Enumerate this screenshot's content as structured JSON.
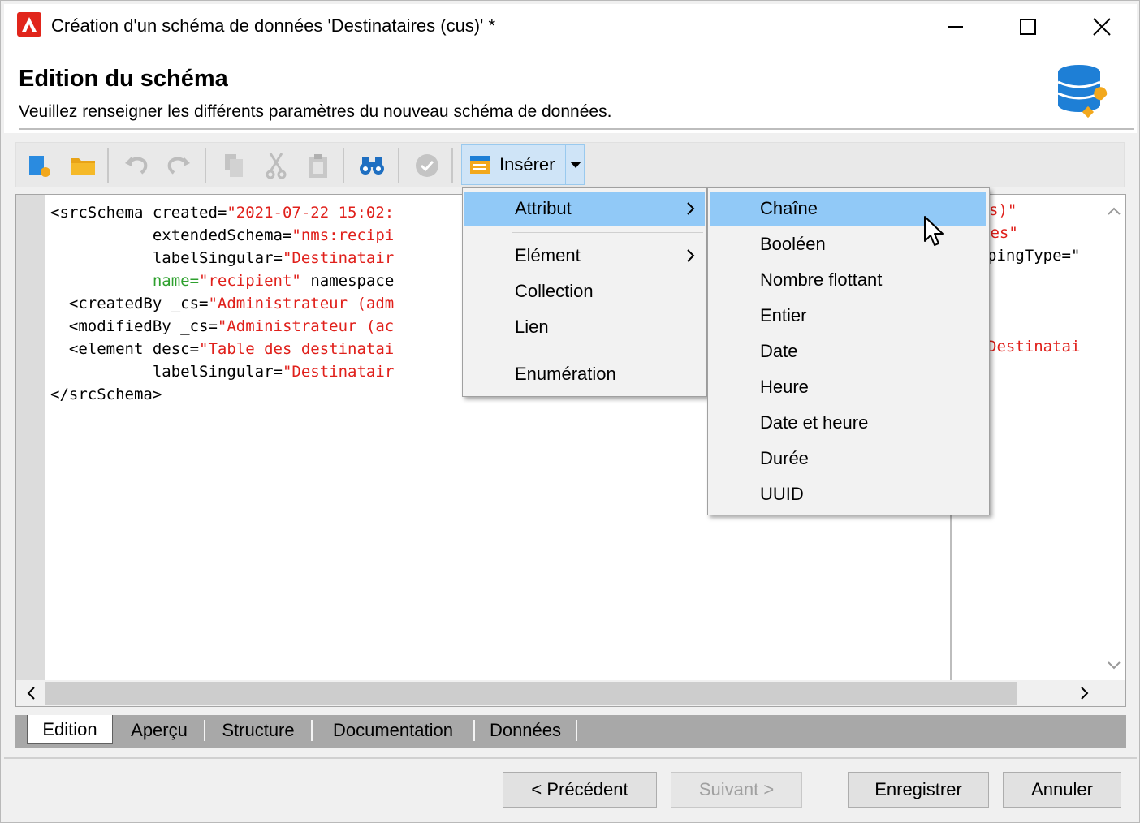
{
  "window": {
    "title": "Création d'un schéma de données 'Destinataires (cus)' *"
  },
  "header": {
    "title": "Edition du schéma",
    "subtitle": "Veuillez renseigner les différents paramètres du nouveau schéma de données."
  },
  "toolbar": {
    "insert_label": "Insérer"
  },
  "code": {
    "line1": [
      "<srcSchema created=",
      "\"2021-07-22 15:02:"
    ],
    "line2": [
      "           extendedSchema=",
      "\"nms:recipi"
    ],
    "line3": [
      "           labelSingular=",
      "\"Destinatair"
    ],
    "line4": [
      "           name=",
      "\"recipient\"",
      " namespace"
    ],
    "line5": [
      "  <createdBy _cs=",
      "\"Administrateur (adm"
    ],
    "line6": [
      "  <modifiedBy _cs=",
      "\"Administrateur (ac"
    ],
    "line7": [
      "  <element desc=",
      "\"Table des destinatai"
    ],
    "line8": [
      "           labelSingular=",
      "\"Destinatair"
    ],
    "line9": "</srcSchema>",
    "right_frags": [
      "s)\"",
      "res\"",
      "pingType=\"",
      "Destinatai"
    ]
  },
  "menu": {
    "items": [
      {
        "label": "Attribut",
        "submenu": true
      },
      {
        "label": "Elément",
        "submenu": true
      },
      {
        "label": "Collection"
      },
      {
        "label": "Lien"
      },
      {
        "label": "Enumération"
      }
    ],
    "submenu_items": [
      "Chaîne",
      "Booléen",
      "Nombre flottant",
      "Entier",
      "Date",
      "Heure",
      "Date et heure",
      "Durée",
      "UUID"
    ]
  },
  "tabs": [
    "Edition",
    "Aperçu",
    "Structure",
    "Documentation",
    "Données"
  ],
  "footer": {
    "prev": "< Précédent",
    "next": "Suivant >",
    "save": "Enregistrer",
    "cancel": "Annuler"
  }
}
